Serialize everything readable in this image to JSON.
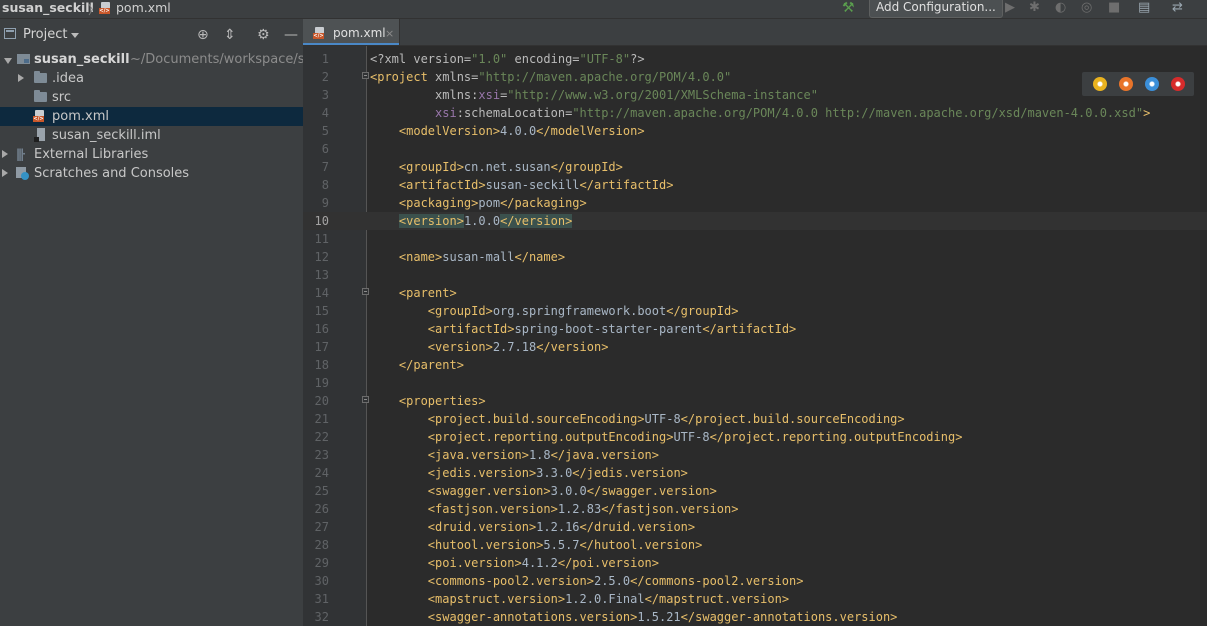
{
  "breadcrumb": {
    "project": "susan_seckill",
    "file": "pom.xml"
  },
  "toolbar": {
    "add_configuration": "Add Configuration..."
  },
  "project_panel": {
    "title": "Project",
    "root": {
      "name": "susan_seckill",
      "path": "~/Documents/workspace/s"
    },
    "items": [
      {
        "label": ".idea"
      },
      {
        "label": "src"
      },
      {
        "label": "pom.xml"
      },
      {
        "label": "susan_seckill.iml"
      },
      {
        "label": "External Libraries"
      },
      {
        "label": "Scratches and Consoles"
      }
    ]
  },
  "editor": {
    "tab_label": "pom.xml",
    "close_glyph": "×",
    "current_line": 10,
    "lines": [
      {
        "n": "1",
        "segs": [
          {
            "t": "<?xml version=",
            "c": "attr"
          },
          {
            "t": "\"1.0\"",
            "c": "val"
          },
          {
            "t": " encoding=",
            "c": "attr"
          },
          {
            "t": "\"UTF-8\"",
            "c": "val"
          },
          {
            "t": "?>",
            "c": "attr"
          }
        ]
      },
      {
        "n": "2",
        "segs": [
          {
            "t": "<project ",
            "c": "tag"
          },
          {
            "t": "xmlns=",
            "c": "attr"
          },
          {
            "t": "\"http://maven.apache.org/POM/4.0.0\"",
            "c": "val"
          }
        ]
      },
      {
        "n": "3",
        "segs": [
          {
            "t": "         xmlns:",
            "c": "attr"
          },
          {
            "t": "xsi",
            "c": "ns"
          },
          {
            "t": "=",
            "c": "attr"
          },
          {
            "t": "\"http://www.w3.org/2001/XMLSchema-instance\"",
            "c": "val"
          }
        ]
      },
      {
        "n": "4",
        "segs": [
          {
            "t": "         ",
            "c": "attr"
          },
          {
            "t": "xsi",
            "c": "ns"
          },
          {
            "t": ":schemaLocation=",
            "c": "attr"
          },
          {
            "t": "\"http://maven.apache.org/POM/4.0.0 http://maven.apache.org/xsd/maven-4.0.0.xsd\"",
            "c": "val"
          },
          {
            "t": ">",
            "c": "tag"
          }
        ]
      },
      {
        "n": "5",
        "segs": [
          {
            "t": "    <modelVersion>",
            "c": "tag"
          },
          {
            "t": "4.0.0",
            "c": "txt"
          },
          {
            "t": "</modelVersion>",
            "c": "tag"
          }
        ]
      },
      {
        "n": "6",
        "segs": []
      },
      {
        "n": "7",
        "segs": [
          {
            "t": "    <groupId>",
            "c": "tag"
          },
          {
            "t": "cn.net.susan",
            "c": "txt"
          },
          {
            "t": "</groupId>",
            "c": "tag"
          }
        ]
      },
      {
        "n": "8",
        "segs": [
          {
            "t": "    <artifactId>",
            "c": "tag"
          },
          {
            "t": "susan-seckill",
            "c": "txt"
          },
          {
            "t": "</artifactId>",
            "c": "tag"
          }
        ]
      },
      {
        "n": "9",
        "segs": [
          {
            "t": "    <packaging>",
            "c": "tag"
          },
          {
            "t": "pom",
            "c": "txt"
          },
          {
            "t": "</packaging>",
            "c": "tag"
          }
        ]
      },
      {
        "n": "10",
        "segs": [
          {
            "t": "    ",
            "c": "txt"
          },
          {
            "t": "<version>",
            "c": "tag hl"
          },
          {
            "t": "1.0.0",
            "c": "txt"
          },
          {
            "t": "</version>",
            "c": "tag hl"
          }
        ]
      },
      {
        "n": "11",
        "segs": []
      },
      {
        "n": "12",
        "segs": [
          {
            "t": "    <name>",
            "c": "tag"
          },
          {
            "t": "susan-mall",
            "c": "txt"
          },
          {
            "t": "</name>",
            "c": "tag"
          }
        ]
      },
      {
        "n": "13",
        "segs": []
      },
      {
        "n": "14",
        "segs": [
          {
            "t": "    <parent>",
            "c": "tag"
          }
        ]
      },
      {
        "n": "15",
        "segs": [
          {
            "t": "        <groupId>",
            "c": "tag"
          },
          {
            "t": "org.springframework.boot",
            "c": "txt"
          },
          {
            "t": "</groupId>",
            "c": "tag"
          }
        ]
      },
      {
        "n": "16",
        "segs": [
          {
            "t": "        <artifactId>",
            "c": "tag"
          },
          {
            "t": "spring-boot-starter-parent",
            "c": "txt"
          },
          {
            "t": "</artifactId>",
            "c": "tag"
          }
        ]
      },
      {
        "n": "17",
        "segs": [
          {
            "t": "        <version>",
            "c": "tag"
          },
          {
            "t": "2.7.18",
            "c": "txt"
          },
          {
            "t": "</version>",
            "c": "tag"
          }
        ]
      },
      {
        "n": "18",
        "segs": [
          {
            "t": "    </parent>",
            "c": "tag"
          }
        ]
      },
      {
        "n": "19",
        "segs": []
      },
      {
        "n": "20",
        "segs": [
          {
            "t": "    <properties>",
            "c": "tag"
          }
        ]
      },
      {
        "n": "21",
        "segs": [
          {
            "t": "        <project.build.sourceEncoding>",
            "c": "tag"
          },
          {
            "t": "UTF-8",
            "c": "txt"
          },
          {
            "t": "</project.build.sourceEncoding>",
            "c": "tag"
          }
        ]
      },
      {
        "n": "22",
        "segs": [
          {
            "t": "        <project.reporting.outputEncoding>",
            "c": "tag"
          },
          {
            "t": "UTF-8",
            "c": "txt"
          },
          {
            "t": "</project.reporting.outputEncoding>",
            "c": "tag"
          }
        ]
      },
      {
        "n": "23",
        "segs": [
          {
            "t": "        <java.version>",
            "c": "tag"
          },
          {
            "t": "1.8",
            "c": "txt"
          },
          {
            "t": "</java.version>",
            "c": "tag"
          }
        ]
      },
      {
        "n": "24",
        "segs": [
          {
            "t": "        <jedis.version>",
            "c": "tag"
          },
          {
            "t": "3.3.0",
            "c": "txt"
          },
          {
            "t": "</jedis.version>",
            "c": "tag"
          }
        ]
      },
      {
        "n": "25",
        "segs": [
          {
            "t": "        <swagger.version>",
            "c": "tag"
          },
          {
            "t": "3.0.0",
            "c": "txt"
          },
          {
            "t": "</swagger.version>",
            "c": "tag"
          }
        ]
      },
      {
        "n": "26",
        "segs": [
          {
            "t": "        <fastjson.version>",
            "c": "tag"
          },
          {
            "t": "1.2.83",
            "c": "txt"
          },
          {
            "t": "</fastjson.version>",
            "c": "tag"
          }
        ]
      },
      {
        "n": "27",
        "segs": [
          {
            "t": "        <druid.version>",
            "c": "tag"
          },
          {
            "t": "1.2.16",
            "c": "txt"
          },
          {
            "t": "</druid.version>",
            "c": "tag"
          }
        ]
      },
      {
        "n": "28",
        "segs": [
          {
            "t": "        <hutool.version>",
            "c": "tag"
          },
          {
            "t": "5.5.7",
            "c": "txt"
          },
          {
            "t": "</hutool.version>",
            "c": "tag"
          }
        ]
      },
      {
        "n": "29",
        "segs": [
          {
            "t": "        <poi.version>",
            "c": "tag"
          },
          {
            "t": "4.1.2",
            "c": "txt"
          },
          {
            "t": "</poi.version>",
            "c": "tag"
          }
        ]
      },
      {
        "n": "30",
        "segs": [
          {
            "t": "        <commons-pool2.version>",
            "c": "tag"
          },
          {
            "t": "2.5.0",
            "c": "txt"
          },
          {
            "t": "</commons-pool2.version>",
            "c": "tag"
          }
        ]
      },
      {
        "n": "31",
        "segs": [
          {
            "t": "        <mapstruct.version>",
            "c": "tag"
          },
          {
            "t": "1.2.0.Final",
            "c": "txt"
          },
          {
            "t": "</mapstruct.version>",
            "c": "tag"
          }
        ]
      },
      {
        "n": "32",
        "segs": [
          {
            "t": "        <swagger-annotations.version>",
            "c": "tag"
          },
          {
            "t": "1.5.21",
            "c": "txt"
          },
          {
            "t": "</swagger-annotations.version>",
            "c": "tag"
          }
        ]
      }
    ]
  },
  "icons": {
    "folder": "folder-icon",
    "module": "module-icon",
    "xml_file": "xml-file-icon",
    "libraries": "libraries-icon",
    "scratches": "scratches-icon"
  },
  "browser_colors": {
    "chrome": "#e9b21f",
    "firefox": "#e8742a",
    "safari": "#3b8fd9",
    "opera": "#d62b2b"
  }
}
